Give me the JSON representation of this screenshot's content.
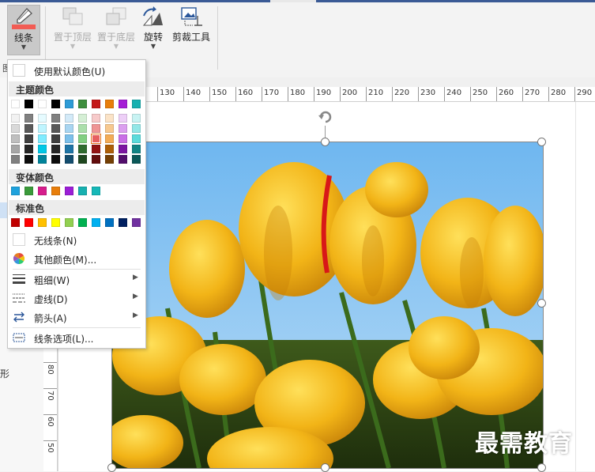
{
  "ribbon": {
    "buttons": [
      {
        "label": "线条",
        "icon": "line-color-icon"
      },
      {
        "label": "置于顶层",
        "icon": "bring-to-front-icon"
      },
      {
        "label": "置于底层",
        "icon": "send-to-back-icon"
      },
      {
        "label": "旋转",
        "icon": "rotate-icon"
      },
      {
        "label": "剪裁工具",
        "icon": "crop-tool-icon"
      }
    ],
    "group_stub": "图"
  },
  "dropdown": {
    "use_default": "使用默认颜色(U)",
    "theme_header": "主题颜色",
    "theme_colors": {
      "base": [
        "#ffffff",
        "#000000",
        "#ffffff",
        "#000000",
        "#2e9bd6",
        "#3e8f3e",
        "#c41a1a",
        "#e87e0b",
        "#a51ed6",
        "#17b0b0"
      ],
      "shades": [
        [
          "#f2f2f2",
          "#d9d9d9",
          "#bfbfbf",
          "#a6a6a6",
          "#808080"
        ],
        [
          "#808080",
          "#595959",
          "#404040",
          "#262626",
          "#0d0d0d"
        ],
        [
          "#e6fbff",
          "#bff5ff",
          "#80ecff",
          "#00c8e6",
          "#00839a"
        ],
        [
          "#808080",
          "#595959",
          "#404040",
          "#262626",
          "#0d0d0d"
        ],
        [
          "#d3eaf8",
          "#a8d5f1",
          "#7cc0ea",
          "#1f75a6",
          "#144d6e"
        ],
        [
          "#d5efd5",
          "#abdfab",
          "#82cf82",
          "#2f6b2f",
          "#1f471f"
        ],
        [
          "#f7caca",
          "#ef9595",
          "#e76060",
          "#931313",
          "#620d0d"
        ],
        [
          "#fbe3c7",
          "#f7c88f",
          "#f3ac57",
          "#ad5f08",
          "#743f05"
        ],
        [
          "#edcff7",
          "#db9fef",
          "#c96fe6",
          "#7c16a1",
          "#520e6b"
        ],
        [
          "#c8f3f3",
          "#92e7e7",
          "#5bdbdb",
          "#118484",
          "#0b5858"
        ]
      ],
      "selected": {
        "column": 6,
        "row": 2
      }
    },
    "variant_header": "变体颜色",
    "variant_colors": [
      "#1fa2dd",
      "#3a9a3a",
      "#d61d8c",
      "#e87e0b",
      "#9b1ed6",
      "#17b0b0",
      "#16b8b8"
    ],
    "standard_header": "标准色",
    "standard_colors": [
      "#c00000",
      "#ff0000",
      "#ffc000",
      "#ffff00",
      "#92d050",
      "#00b050",
      "#00b0f0",
      "#0070c0",
      "#002060",
      "#7030a0"
    ],
    "no_line": "无线条(N)",
    "more_colors": "其他颜色(M)...",
    "weight": "粗细(W)",
    "dashes": "虚线(D)",
    "arrows": "箭头(A)",
    "line_options": "线条选项(L)..."
  },
  "ruler": {
    "horizontal": [
      "130",
      "140",
      "150",
      "160",
      "170",
      "180",
      "190",
      "200",
      "210",
      "220",
      "230",
      "240",
      "250",
      "260",
      "270",
      "280",
      "290"
    ],
    "vertical": [
      "80",
      "70",
      "60",
      "50"
    ]
  },
  "left_panel": {
    "shape_label": "形"
  },
  "watermark": "最需教育",
  "colors": {
    "accent": "#2b579a",
    "selected_swatch_border": "#e3731c"
  }
}
